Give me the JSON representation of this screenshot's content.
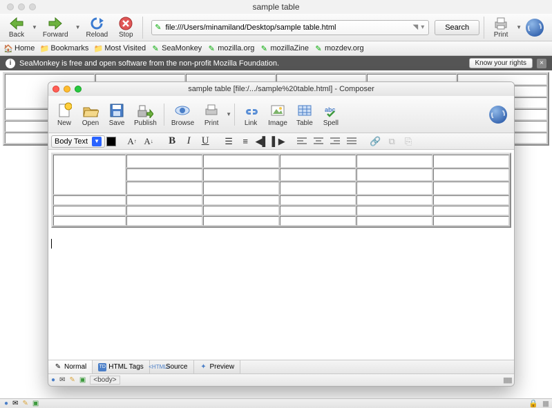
{
  "os": {
    "window_title": "sample table"
  },
  "nav": {
    "back": "Back",
    "forward": "Forward",
    "reload": "Reload",
    "stop": "Stop",
    "url": "file:///Users/minamiland/Desktop/sample table.html",
    "search_label": "Search",
    "print": "Print"
  },
  "bookmarks": {
    "home": "Home",
    "bookmarks": "Bookmarks",
    "most_visited": "Most Visited",
    "seamonkey": "SeaMonkey",
    "mozilla_org": "mozilla.org",
    "mozillazine": "mozillaZine",
    "mozdev": "mozdev.org"
  },
  "rights": {
    "message": "SeaMonkey is free and open software from the non-profit Mozilla Foundation.",
    "button": "Know your rights"
  },
  "composer": {
    "title": "sample table [file:/.../sample%20table.html] - Composer",
    "toolbar": {
      "new": "New",
      "open": "Open",
      "save": "Save",
      "publish": "Publish",
      "browse": "Browse",
      "print": "Print",
      "link": "Link",
      "image": "Image",
      "table": "Table",
      "spell": "Spell"
    },
    "format": {
      "style": "Body Text"
    },
    "tabs": {
      "normal": "Normal",
      "html_tags": "HTML Tags",
      "source": "Source",
      "preview": "Preview"
    },
    "status": {
      "body_tag": "<body>"
    }
  }
}
